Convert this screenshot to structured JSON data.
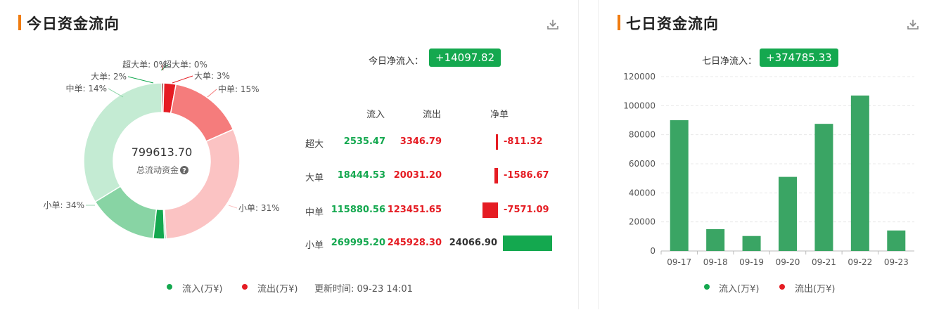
{
  "colors": {
    "accent": "#f07c10",
    "green": "#14a84f",
    "red": "#e51c23",
    "bar": "#3aa564"
  },
  "left_panel": {
    "title": "今日资金流向",
    "net_label": "今日净流入：",
    "net_value": "+14097.82",
    "center_value": "799613.70",
    "center_label": "总流动资金",
    "table_headers": [
      "流入",
      "流出",
      "净单"
    ],
    "rows": [
      {
        "name": "超大",
        "inflow": "2535.47",
        "outflow": "3346.79",
        "net": "-811.32",
        "net_num": -811.32
      },
      {
        "name": "大单",
        "inflow": "18444.53",
        "outflow": "20031.20",
        "net": "-1586.67",
        "net_num": -1586.67
      },
      {
        "name": "中单",
        "inflow": "115880.56",
        "outflow": "123451.65",
        "net": "-7571.09",
        "net_num": -7571.09
      },
      {
        "name": "小单",
        "inflow": "269995.20",
        "outflow": "245928.30",
        "net": "24066.90",
        "net_num": 24066.9
      }
    ],
    "legend": [
      "流入(万¥)",
      "流出(万¥)"
    ],
    "update_time": "更新时间: 09-23 14:01"
  },
  "right_panel": {
    "title": "七日资金流向",
    "net_label": "七日净流入：",
    "net_value": "+374785.33",
    "legend": [
      "流入(万¥)",
      "流出(万¥)"
    ]
  },
  "chart_data": [
    {
      "type": "pie",
      "style": "donut",
      "slices": [
        {
          "label": "超大单: 0%",
          "value": 2535.47,
          "side": "inflow",
          "color": "#14a84f"
        },
        {
          "label": "大单: 2%",
          "value": 18444.53,
          "side": "inflow",
          "color": "#14a84f"
        },
        {
          "label": "中单: 14%",
          "value": 115880.56,
          "side": "inflow",
          "color": "#88d4a4"
        },
        {
          "label": "小单: 34%",
          "value": 269995.2,
          "side": "inflow",
          "color": "#c4ebd3"
        },
        {
          "label": "小单: 31%",
          "value": 245928.3,
          "side": "outflow",
          "color": "#fbc3c3"
        },
        {
          "label": "中单: 15%",
          "value": 123451.65,
          "side": "outflow",
          "color": "#f57c7c"
        },
        {
          "label": "大单: 3%",
          "value": 20031.2,
          "side": "outflow",
          "color": "#e51c23"
        },
        {
          "label": "超大单: 0%",
          "value": 3346.79,
          "side": "outflow",
          "color": "#8b1a1a"
        }
      ]
    },
    {
      "type": "bar",
      "categories": [
        "09-17",
        "09-18",
        "09-19",
        "09-20",
        "09-21",
        "09-22",
        "09-23"
      ],
      "values": [
        90000,
        15000,
        10300,
        51000,
        87500,
        107000,
        14100
      ],
      "ylim": [
        0,
        120000
      ],
      "yticks": [
        0,
        20000,
        40000,
        60000,
        80000,
        100000,
        120000
      ],
      "grid": true
    }
  ]
}
